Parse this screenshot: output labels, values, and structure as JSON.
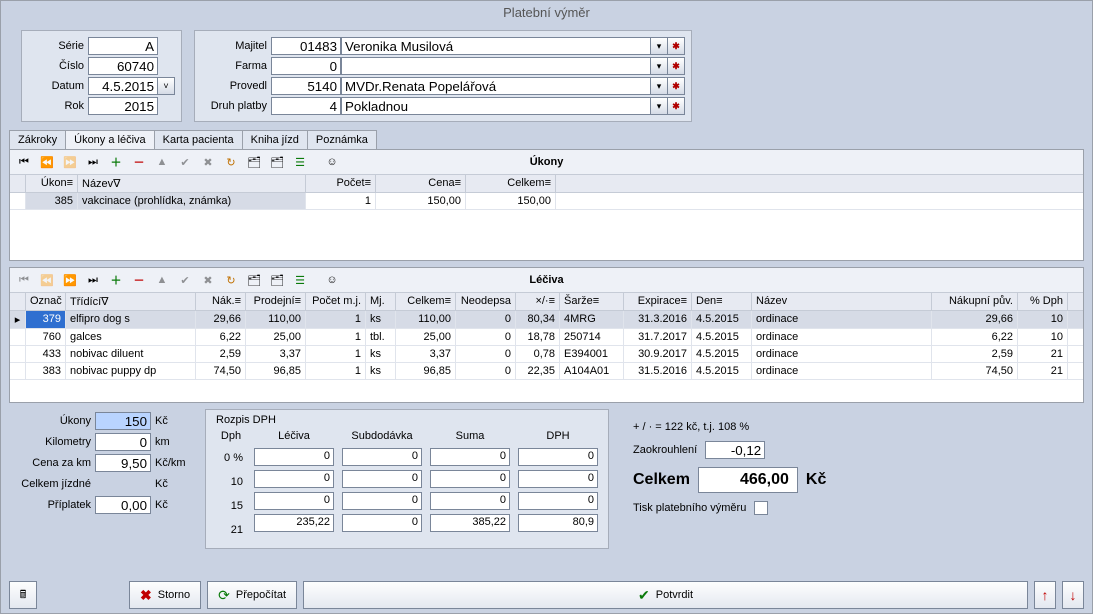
{
  "title": "Platební výměr",
  "headerLeft": {
    "serie": {
      "label": "Série",
      "value": "A"
    },
    "cislo": {
      "label": "Číslo",
      "value": "60740"
    },
    "datum": {
      "label": "Datum",
      "value": "4.5.2015"
    },
    "rok": {
      "label": "Rok",
      "value": "2015"
    }
  },
  "headerRight": {
    "majitel": {
      "label": "Majitel",
      "code": "01483",
      "text": "Veronika Musilová"
    },
    "farma": {
      "label": "Farma",
      "code": "0",
      "text": ""
    },
    "provedl": {
      "label": "Provedl",
      "code": "5140",
      "text": "MVDr.Renata Popelářová"
    },
    "platba": {
      "label": "Druh platby",
      "code": "4",
      "text": "Pokladnou"
    }
  },
  "tabs": [
    "Zákroky",
    "Úkony a léčiva",
    "Karta pacienta",
    "Kniha jízd",
    "Poznámka"
  ],
  "activeTab": 1,
  "ukony": {
    "title": "Úkony",
    "headers": [
      "Úkon≡",
      "Název∇",
      "Počet≡",
      "Cena≡",
      "Celkem≡"
    ],
    "rows": [
      {
        "ukon": "385",
        "nazev": "vakcinace (prohlídka, známka)",
        "pocet": "1",
        "cena": "150,00",
        "celkem": "150,00"
      }
    ]
  },
  "leciva": {
    "title": "Léčiva",
    "headers": [
      "Označ",
      "Třídící∇",
      "Nák.≡",
      "Prodejní≡",
      "Počet m.j.",
      "Mj.",
      "Celkem≡",
      "Neodepsa",
      "×/·≡",
      "Šarže≡",
      "Expirace≡",
      "Den≡",
      "Název",
      "Nákupní pův.",
      "% Dph"
    ],
    "rows": [
      {
        "ozn": "379",
        "trid": "elfipro dog s",
        "nak": "29,66",
        "prod": "110,00",
        "poc": "1",
        "mj": "ks",
        "cel": "110,00",
        "neo": "0",
        "xx": "80,34",
        "sarze": "4MRG",
        "exp": "31.3.2016",
        "den": "4.5.2015",
        "nazev": "ordinace",
        "npuv": "29,66",
        "dph": "10"
      },
      {
        "ozn": "760",
        "trid": "galces",
        "nak": "6,22",
        "prod": "25,00",
        "poc": "1",
        "mj": "tbl.",
        "cel": "25,00",
        "neo": "0",
        "xx": "18,78",
        "sarze": "250714",
        "exp": "31.7.2017",
        "den": "4.5.2015",
        "nazev": "ordinace",
        "npuv": "6,22",
        "dph": "10"
      },
      {
        "ozn": "433",
        "trid": "nobivac diluent",
        "nak": "2,59",
        "prod": "3,37",
        "poc": "1",
        "mj": "ks",
        "cel": "3,37",
        "neo": "0",
        "xx": "0,78",
        "sarze": "E394001",
        "exp": "30.9.2017",
        "den": "4.5.2015",
        "nazev": "ordinace",
        "npuv": "2,59",
        "dph": "21"
      },
      {
        "ozn": "383",
        "trid": "nobivac puppy dp",
        "nak": "74,50",
        "prod": "96,85",
        "poc": "1",
        "mj": "ks",
        "cel": "96,85",
        "neo": "0",
        "xx": "22,35",
        "sarze": "A104A01",
        "exp": "31.5.2016",
        "den": "4.5.2015",
        "nazev": "ordinace",
        "npuv": "74,50",
        "dph": "21"
      }
    ]
  },
  "sumLeft": {
    "ukony": {
      "label": "Úkony",
      "value": "150",
      "unit": "Kč"
    },
    "km": {
      "label": "Kilometry",
      "value": "0",
      "unit": "km"
    },
    "cenakm": {
      "label": "Cena za km",
      "value": "9,50",
      "unit": "Kč/km"
    },
    "jizdne": {
      "label": "Celkem jízdné",
      "value": "",
      "unit": "Kč"
    },
    "pripl": {
      "label": "Příplatek",
      "value": "0,00",
      "unit": "Kč"
    }
  },
  "dph": {
    "title": "Rozpis DPH",
    "colHeads": [
      "Dph",
      "Léčiva",
      "Subdodávka",
      "Suma",
      "DPH"
    ],
    "rows": [
      {
        "rate": "0 %",
        "lec": "0",
        "sub": "0",
        "sum": "0",
        "dph": "0"
      },
      {
        "rate": "10",
        "lec": "0",
        "sub": "0",
        "sum": "0",
        "dph": "0"
      },
      {
        "rate": "15",
        "lec": "0",
        "sub": "0",
        "sum": "0",
        "dph": "0"
      },
      {
        "rate": "21",
        "lec": "235,22",
        "sub": "0",
        "sum": "385,22",
        "dph": "80,9"
      }
    ]
  },
  "rightSum": {
    "pctLine": "+ / · = 122 kč, t.j. 108 %",
    "zaokLabel": "Zaokrouhlení",
    "zaokValue": "-0,12",
    "celkemLabel": "Celkem",
    "celkemValue": "466,00",
    "celkemUnit": "Kč",
    "tiskLabel": "Tisk platebního výměru"
  },
  "footer": {
    "storno": "Storno",
    "prepocitat": "Přepočítat",
    "potvrdit": "Potvrdit"
  }
}
